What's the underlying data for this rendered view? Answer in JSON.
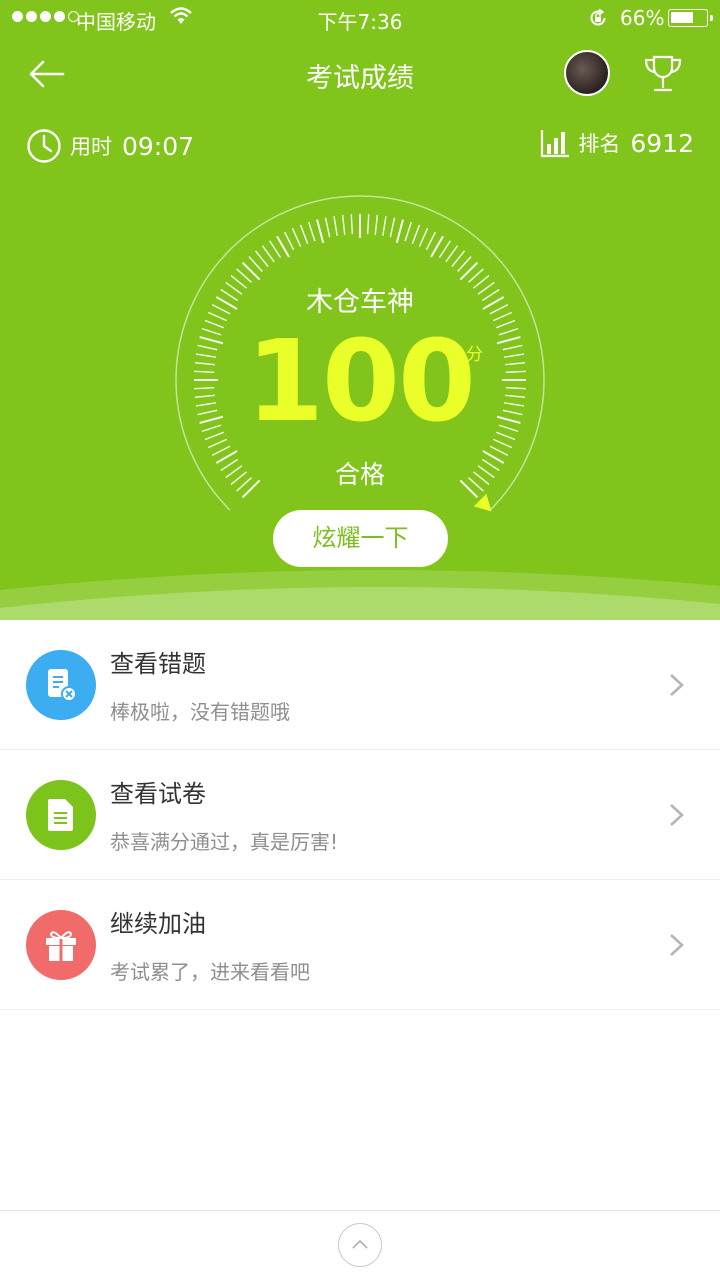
{
  "status_bar": {
    "carrier": "中国移动",
    "time": "下午7:36",
    "battery_percent": "66%",
    "battery_level": 0.66,
    "signal_bars": 4
  },
  "header": {
    "title": "考试成绩",
    "back_icon": "arrow-left-icon",
    "trophy_icon": "trophy-icon"
  },
  "stats": {
    "time_label": "用时",
    "time_value": "09:07",
    "rank_label": "排名",
    "rank_value": "6912"
  },
  "result": {
    "rank_title": "木仓车神",
    "score": "100",
    "unit": "分",
    "status": "合格",
    "share_button": "炫耀一下",
    "gauge_fraction": 1.0
  },
  "list": [
    {
      "title": "查看错题",
      "subtitle": "棒极啦，没有错题哦",
      "icon": "wrong-questions-icon",
      "color": "#3badf0"
    },
    {
      "title": "查看试卷",
      "subtitle": "恭喜满分通过，真是厉害!",
      "icon": "exam-paper-icon",
      "color": "#7cc31b"
    },
    {
      "title": "继续加油",
      "subtitle": "考试累了，进来看看吧",
      "icon": "gift-icon",
      "color": "#f26b6b"
    }
  ],
  "colors": {
    "hero": "#80c41c",
    "score": "#eaff2a"
  }
}
